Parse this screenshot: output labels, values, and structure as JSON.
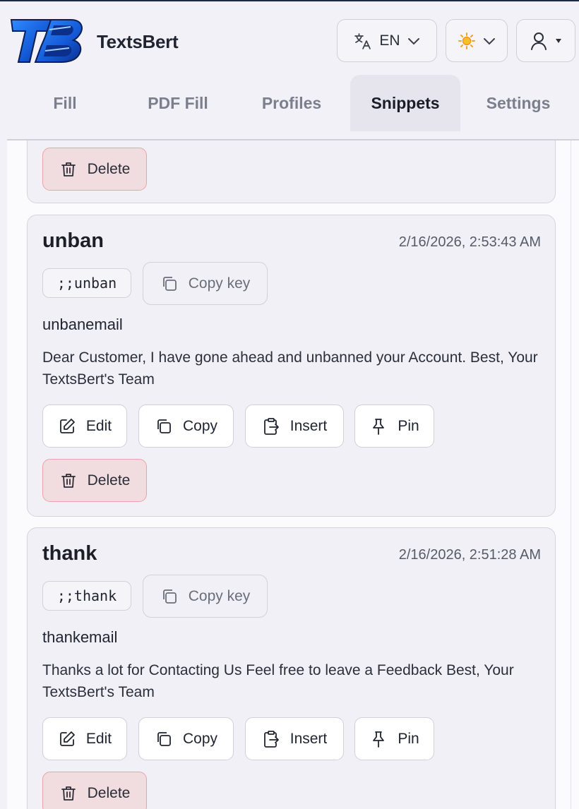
{
  "app": {
    "brand": "TextsBert",
    "logo_letters": "TB",
    "language_code": "EN"
  },
  "header_icons": {
    "language": "translate-icon",
    "theme": "sun-icon",
    "user": "user-icon",
    "chevron": "chevron-down-icon",
    "caret": "caret-down-icon"
  },
  "tabs": [
    {
      "label": "Fill",
      "active": false
    },
    {
      "label": "PDF Fill",
      "active": false
    },
    {
      "label": "Profiles",
      "active": false
    },
    {
      "label": "Snippets",
      "active": true
    },
    {
      "label": "Settings",
      "active": false
    }
  ],
  "colors": {
    "accent_blue": "#1458d6",
    "delete_bg": "#f1dcdf",
    "delete_border": "#e9a4a7",
    "active_tab_bg": "#e6e5ee"
  },
  "labels": {
    "copy_key": "Copy key",
    "edit": "Edit",
    "copy": "Copy",
    "insert": "Insert",
    "pin": "Pin",
    "delete": "Delete"
  },
  "snippets": [
    {
      "title": "unban",
      "date": "2/16/2026, 2:53:43 AM",
      "key": ";;unban",
      "name": "unbanemail",
      "text": "Dear Customer, I have gone ahead and unbanned your Account. Best, Your TextsBert's Team"
    },
    {
      "title": "thank",
      "date": "2/16/2026, 2:51:28 AM",
      "key": ";;thank",
      "name": "thankemail",
      "text": "Thanks a lot for Contacting Us Feel free to leave a Feedback Best, Your TextsBert's Team"
    }
  ]
}
